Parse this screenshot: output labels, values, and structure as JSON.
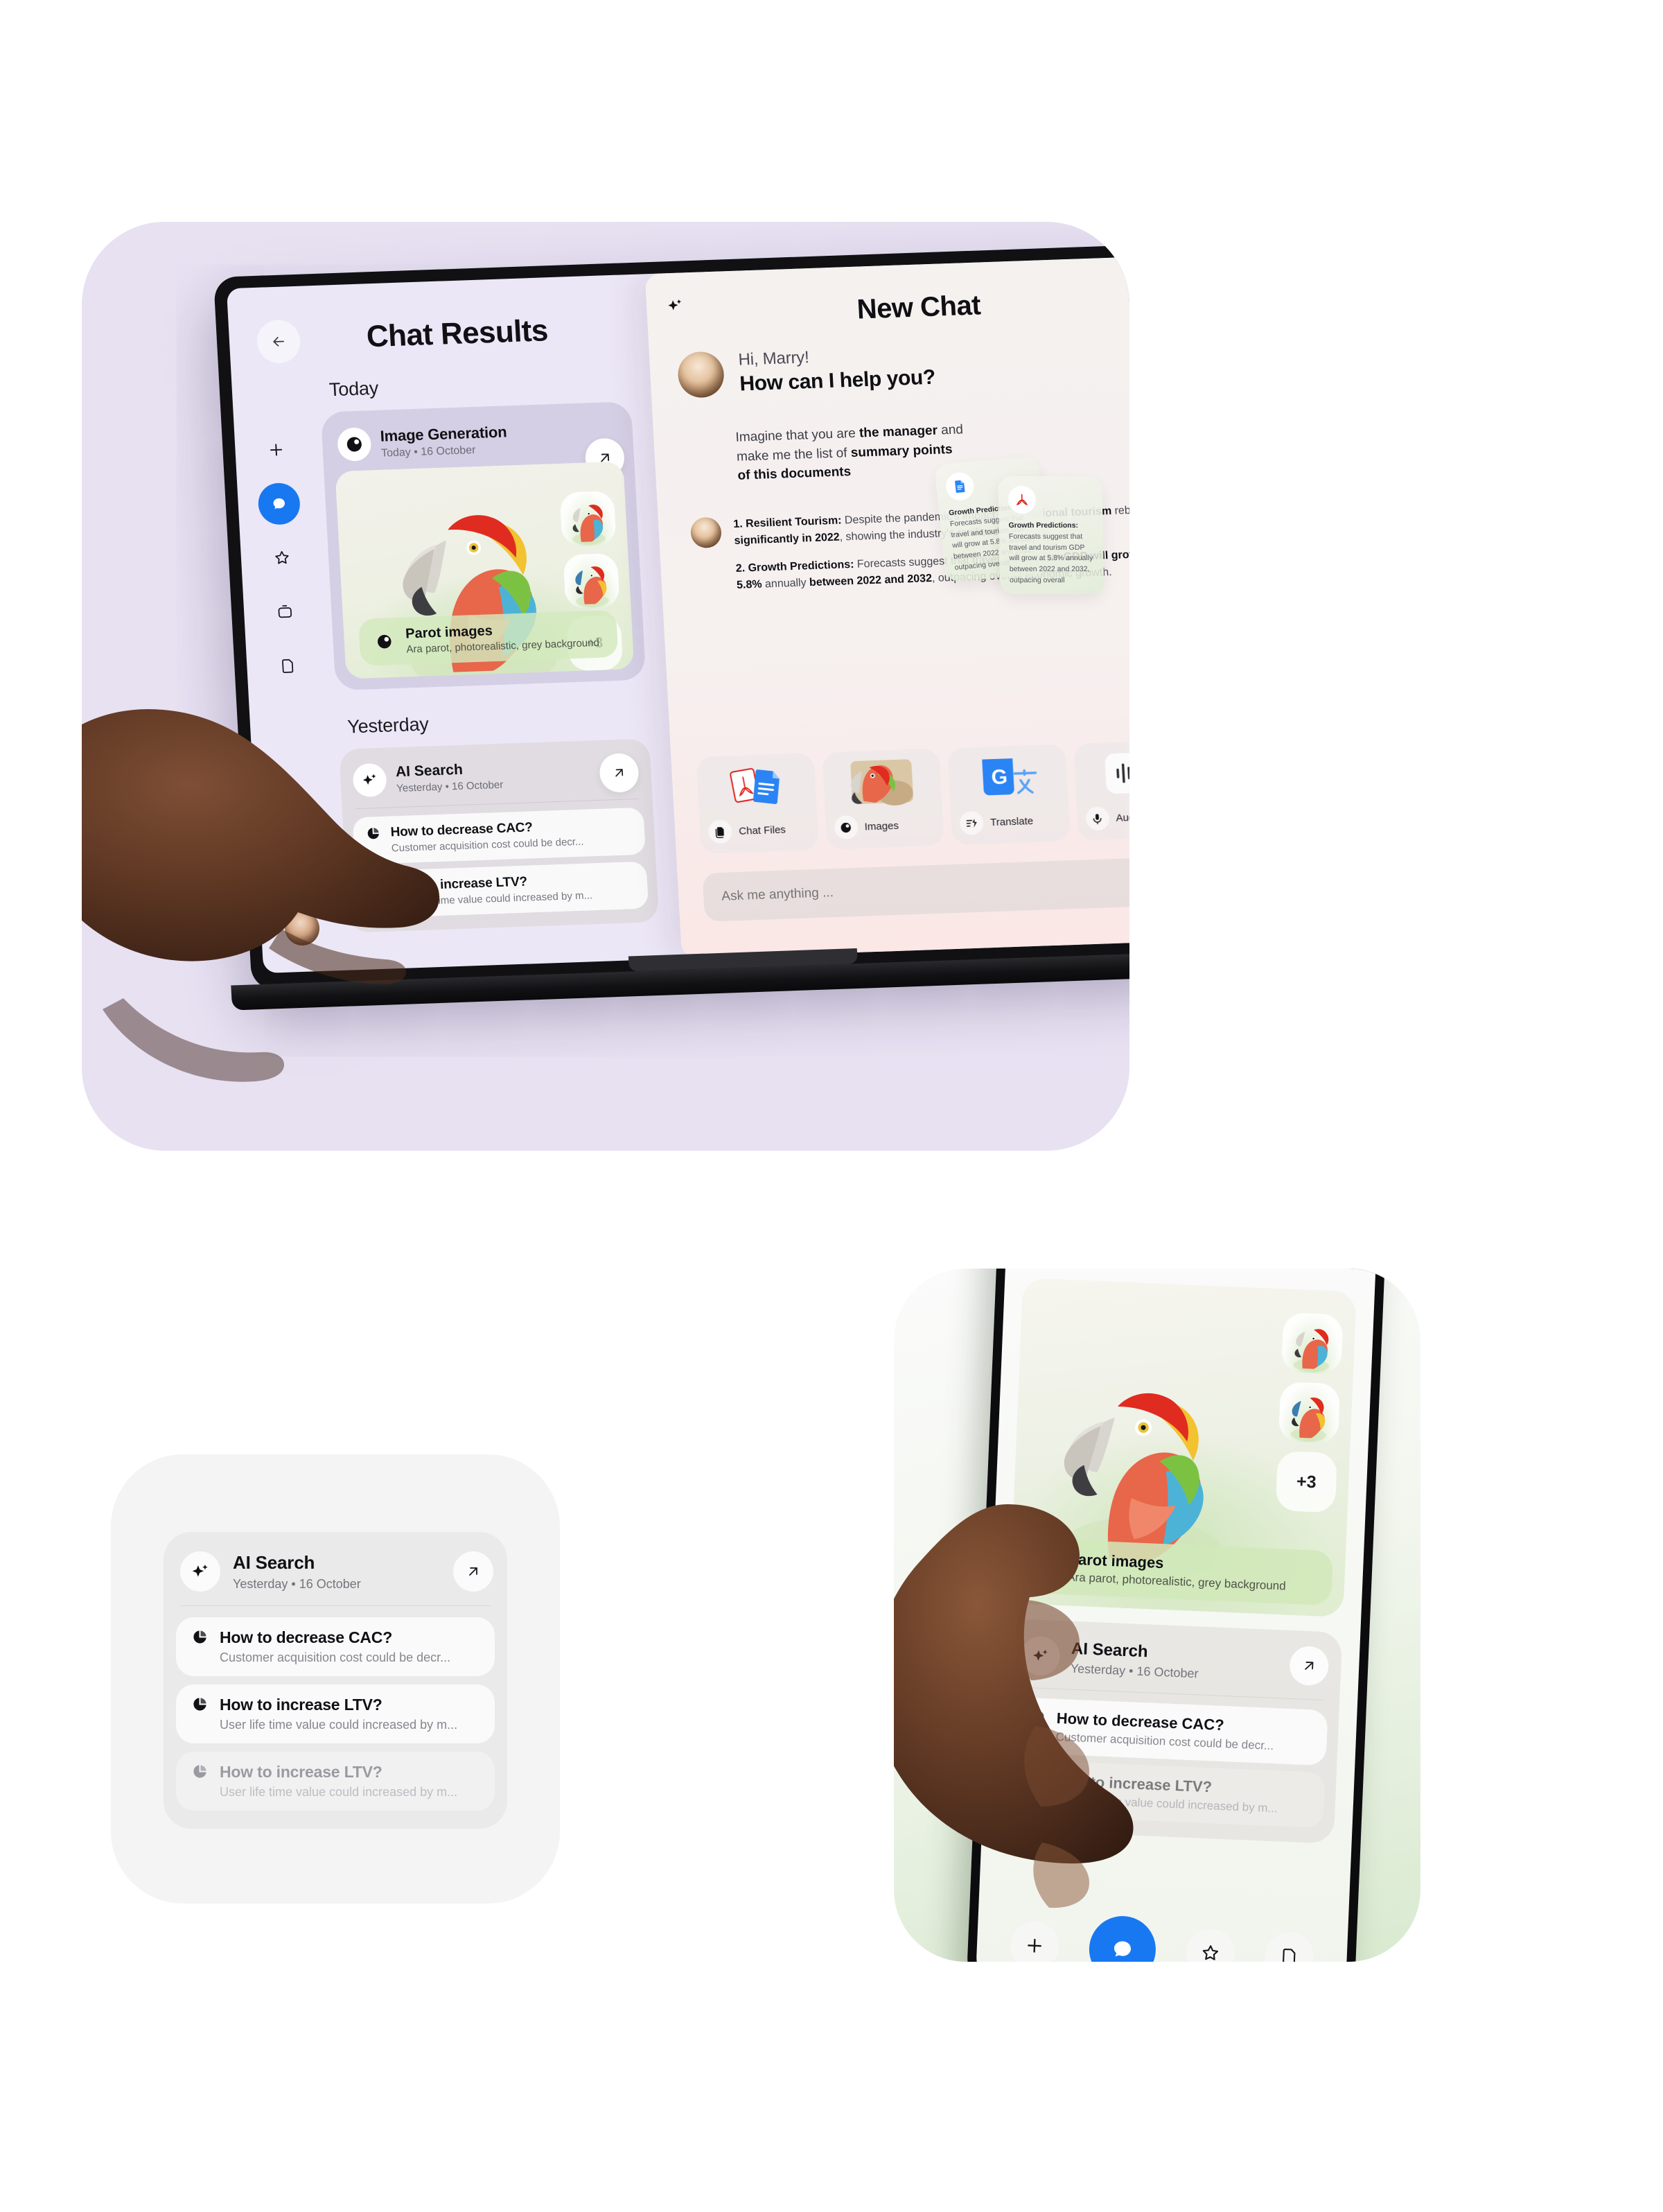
{
  "app": {
    "accent_color": "#1878f2",
    "laptop_tile_bg": "#e7e1f2",
    "card_tile_bg": "#f4f4f4"
  },
  "laptop": {
    "rail": {
      "items": [
        {
          "name": "new-chat",
          "icon": "plus-icon",
          "active": false
        },
        {
          "name": "chat",
          "icon": "chat-bubble-icon",
          "active": true
        },
        {
          "name": "favorites",
          "icon": "star-icon",
          "active": false
        },
        {
          "name": "archive",
          "icon": "archive-box-icon",
          "active": false
        },
        {
          "name": "files",
          "icon": "document-icon",
          "active": false
        }
      ],
      "bottom_items": [
        {
          "name": "downloads",
          "icon": "download-icon"
        },
        {
          "name": "settings",
          "icon": "gear-icon"
        }
      ],
      "avatar_label": "User avatar"
    },
    "results": {
      "back_label": "←",
      "title": "Chat Results",
      "sections": [
        {
          "label": "Today"
        },
        {
          "label": "Yesterday"
        }
      ],
      "generation_card": {
        "icon": "image-generation-icon",
        "title": "Image Generation",
        "day": "Today",
        "separator": "•",
        "date": "16 October",
        "open_icon": "arrow-up-right-icon",
        "more_count": "+3",
        "footer_icon": "image-generation-icon",
        "footer_title": "Parot images",
        "footer_subtitle": "Ara parot, photorealistic, grey background"
      },
      "ai_search_card": {
        "icon": "sparkle-icon",
        "title": "AI Search",
        "day": "Yesterday",
        "separator": "•",
        "date": "16 October",
        "open_icon": "arrow-up-right-icon",
        "questions": [
          {
            "icon": "pie-chart-icon",
            "title": "How to decrease CAC?",
            "subtitle": "Customer acquisition cost could be decr...",
            "dim": false
          },
          {
            "icon": "pie-chart-icon",
            "title": "How to increase LTV?",
            "subtitle": "User life time value could  increased by m...",
            "dim": false
          }
        ]
      }
    },
    "chat": {
      "sparkle_icon": "sparkle-icon",
      "title": "New Chat",
      "close_icon": "close-icon",
      "greeting_hi": "Hi, Marry!",
      "greeting_question": "How can I help you?",
      "user_message": {
        "part1": "Imagine that you are ",
        "bold1": "the manager",
        "part2": " and make me the list of ",
        "bold2": "summary points of this documents"
      },
      "attachments": [
        {
          "icon": "google-docs-icon",
          "title": "Growth Predictions:",
          "body": "Forecasts suggest that travel and tourism GDP will grow at 5.8% annually between 2022 and 2032, outpacing overall"
        },
        {
          "icon": "adobe-pdf-icon",
          "title": "Growth Predictions:",
          "body": "Forecasts suggest that travel and tourism GDP will grow at 5.8% annually between 2022 and 2032, outpacing overall"
        }
      ],
      "side_actions": [
        {
          "name": "edit",
          "icon": "edit-square-icon"
        },
        {
          "name": "copy",
          "icon": "copy-icon"
        },
        {
          "name": "more",
          "icon": "ellipsis-icon"
        }
      ],
      "reply": [
        {
          "number": "1.",
          "bold_lead": "Resilient Tourism:",
          "text_a": " Despite the pandemic's impact, ",
          "bold_mid": "international tourism",
          "text_b": " rebounded ",
          "bold_end": "significantly in 2022",
          "text_c": ", showing the industry's resilience."
        },
        {
          "number": "2.",
          "bold_lead": "Growth Predictions:",
          "text_a": " Forecasts suggest that travel and tourism ",
          "bold_mid": "GDP will grow at 5.8%",
          "text_b": " annually ",
          "bold_end": "between 2022 and 2032",
          "text_c": ", outpacing overall economic growth."
        }
      ],
      "tools": [
        {
          "name": "chat-files",
          "label": "Chat Files",
          "icon": "files-stack-icon",
          "art": "pdf-docs-art"
        },
        {
          "name": "images",
          "label": "Images",
          "icon": "image-generation-icon",
          "art": "parrot-photo-art"
        },
        {
          "name": "translate",
          "label": "Translate",
          "icon": "translate-bolt-icon",
          "art": "google-translate-art"
        },
        {
          "name": "audio-chat",
          "label": "Audio Chat",
          "icon": "microphone-icon",
          "art": "waveform-art"
        }
      ],
      "composer_placeholder": "Ask me anything ...",
      "send_icon": "arrow-up-icon"
    }
  },
  "card_component": {
    "icon": "sparkle-icon",
    "title": "AI Search",
    "day": "Yesterday",
    "separator": "•",
    "date": "16 October",
    "open_icon": "arrow-up-right-icon",
    "questions": [
      {
        "icon": "pie-chart-icon",
        "title": "How to decrease CAC?",
        "subtitle": "Customer acquisition cost could be decr...",
        "dim": false
      },
      {
        "icon": "pie-chart-icon",
        "title": "How to increase LTV?",
        "subtitle": "User life time value could  increased by m...",
        "dim": false
      },
      {
        "icon": "pie-chart-icon",
        "title": "How to increase LTV?",
        "subtitle": "User life time value could  increased by m...",
        "dim": true
      }
    ]
  },
  "phone": {
    "generation_card": {
      "more_count": "+3",
      "footer_icon": "image-generation-icon",
      "footer_title": "Parot images",
      "footer_subtitle": "Ara parot, photorealistic, grey background"
    },
    "ai_search_card": {
      "icon": "sparkle-icon",
      "title": "AI Search",
      "day": "Yesterday",
      "separator": "•",
      "date": "16 October",
      "open_icon": "arrow-up-right-icon",
      "questions": [
        {
          "icon": "pie-chart-icon",
          "title": "How to decrease CAC?",
          "subtitle": "Customer acquisition cost could be decr...",
          "dim": false
        },
        {
          "icon": "pie-chart-icon",
          "title": "How to increase LTV?",
          "subtitle": "User life time value could  increased by m...",
          "dim": true
        }
      ]
    },
    "nav": [
      {
        "name": "add",
        "icon": "plus-icon",
        "active": false
      },
      {
        "name": "chat",
        "icon": "chat-bubble-icon",
        "active": true
      },
      {
        "name": "favorites",
        "icon": "star-icon",
        "active": false
      },
      {
        "name": "files",
        "icon": "document-icon",
        "active": false
      }
    ]
  }
}
